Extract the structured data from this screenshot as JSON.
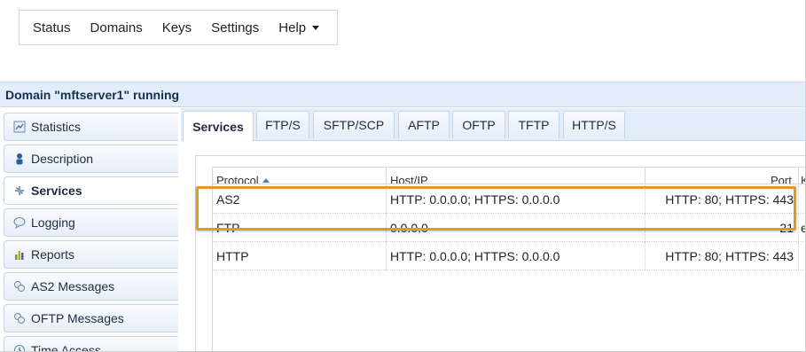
{
  "menu": {
    "items": [
      {
        "label": "Status"
      },
      {
        "label": "Domains"
      },
      {
        "label": "Keys"
      },
      {
        "label": "Settings"
      },
      {
        "label": "Help"
      }
    ]
  },
  "domain": {
    "title": "Domain \"mftserver1\" running"
  },
  "sidebar": {
    "items": [
      {
        "label": "Statistics",
        "icon": "statistics-icon"
      },
      {
        "label": "Description",
        "icon": "description-icon"
      },
      {
        "label": "Services",
        "icon": "services-icon",
        "active": true
      },
      {
        "label": "Logging",
        "icon": "logging-icon"
      },
      {
        "label": "Reports",
        "icon": "reports-icon"
      },
      {
        "label": "AS2 Messages",
        "icon": "as2-messages-icon"
      },
      {
        "label": "OFTP Messages",
        "icon": "oftp-messages-icon"
      },
      {
        "label": "Time Access",
        "icon": "time-access-icon"
      }
    ]
  },
  "tabs": [
    {
      "label": "Services",
      "active": true
    },
    {
      "label": "FTP/S"
    },
    {
      "label": "SFTP/SCP"
    },
    {
      "label": "AFTP"
    },
    {
      "label": "OFTP"
    },
    {
      "label": "TFTP"
    },
    {
      "label": "HTTP/S"
    }
  ],
  "table": {
    "columns": [
      "Protocol",
      "Host/IP",
      "Port",
      "K"
    ],
    "sort_column": "Protocol",
    "rows": [
      {
        "protocol": "AS2",
        "host": "HTTP: 0.0.0.0; HTTPS: 0.0.0.0",
        "port": "HTTP: 80; HTTPS: 443",
        "extra": "",
        "highlighted": true
      },
      {
        "protocol": "FTP",
        "host": "0.0.0.0",
        "port": "21",
        "extra": "e"
      },
      {
        "protocol": "HTTP",
        "host": "HTTP: 0.0.0.0; HTTPS: 0.0.0.0",
        "port": "HTTP: 80; HTTPS: 443",
        "extra": ""
      }
    ]
  },
  "colors": {
    "accent_highlight": "#e39a22",
    "header_bar": "#e3edf9",
    "title_text": "#15314f"
  }
}
